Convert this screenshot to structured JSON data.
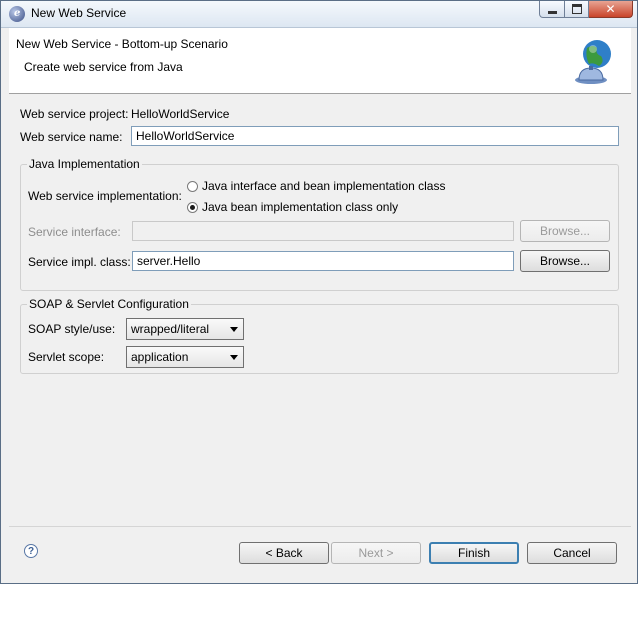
{
  "window": {
    "title": "New Web Service",
    "app_icon_letter": "e"
  },
  "banner": {
    "title": "New Web Service - Bottom-up Scenario",
    "subtitle": "Create web service from Java"
  },
  "project": {
    "label": "Web service project:",
    "value": "HelloWorldService"
  },
  "name": {
    "label": "Web service name:",
    "value": "HelloWorldService"
  },
  "java_impl": {
    "group_title": "Java Implementation",
    "impl_label": "Web service implementation:",
    "options": [
      {
        "label": "Java interface and bean implementation class",
        "selected": false
      },
      {
        "label": "Java bean implementation class only",
        "selected": true
      }
    ],
    "service_interface": {
      "label": "Service interface:",
      "value": "",
      "button": "Browse...",
      "enabled": false
    },
    "service_impl": {
      "label": "Service impl. class:",
      "value": "server.Hello",
      "button": "Browse...",
      "enabled": true
    }
  },
  "soap": {
    "group_title": "SOAP & Servlet Configuration",
    "style_label": "SOAP style/use:",
    "style_value": "wrapped/literal",
    "scope_label": "Servlet scope:",
    "scope_value": "application"
  },
  "footer": {
    "help_glyph": "?",
    "back": "< Back",
    "next": "Next >",
    "finish": "Finish",
    "cancel": "Cancel"
  },
  "colors": {
    "accent": "#3c7fb1",
    "window_bg": "#f0f0f0"
  }
}
